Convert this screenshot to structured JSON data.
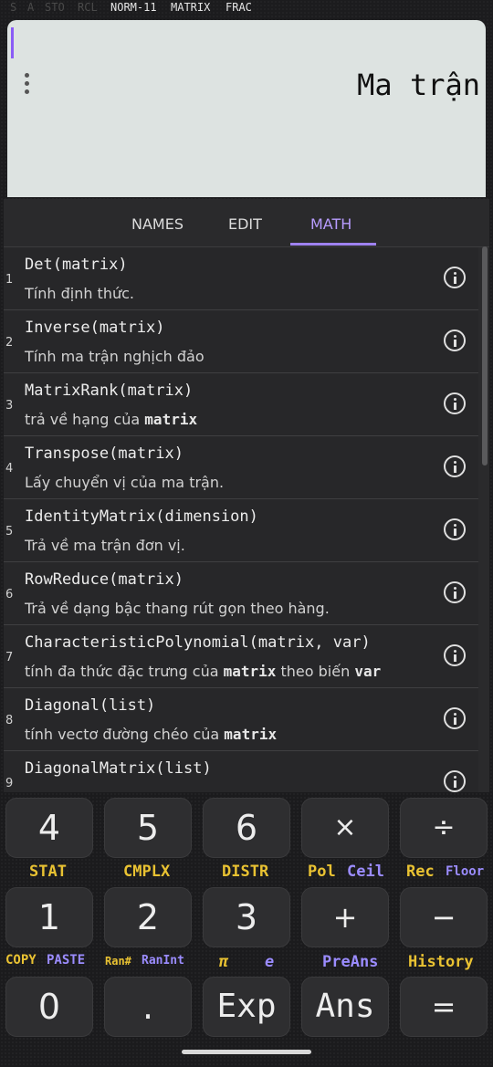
{
  "status": {
    "s": "S",
    "a": "A",
    "sto": "STO",
    "rcl": "RCL",
    "mode": "NORM-11",
    "matrix": "MATRIX",
    "frac": "FRAC"
  },
  "display": {
    "expression": "Ma trận"
  },
  "tabs": [
    "NAMES",
    "EDIT",
    "MATH"
  ],
  "items": [
    {
      "num": "1",
      "fn": "Det(matrix)",
      "desc": "Tính định thức."
    },
    {
      "num": "2",
      "fn": "Inverse(matrix)",
      "desc": "Tính ma trận nghịch đảo"
    },
    {
      "num": "3",
      "fn": "MatrixRank(matrix)",
      "desc_pre": "trả về hạng của ",
      "desc_bold": "matrix"
    },
    {
      "num": "4",
      "fn": "Transpose(matrix)",
      "desc": "Lấy chuyển vị của ma trận."
    },
    {
      "num": "5",
      "fn": "IdentityMatrix(dimension)",
      "desc": "Trả về ma trận đơn vị."
    },
    {
      "num": "6",
      "fn": "RowReduce(matrix)",
      "desc": "Trả về dạng bậc thang rút gọn theo hàng."
    },
    {
      "num": "7",
      "fn": "CharacteristicPolynomial(matrix, var)",
      "desc_pre": "tính đa thức đặc trưng của ",
      "desc_bold": "matrix",
      "desc_mid": " theo biến ",
      "desc_bold2": "var"
    },
    {
      "num": "8",
      "fn": "Diagonal(list)",
      "desc_pre": "tính vectơ đường chéo của ",
      "desc_bold": "matrix"
    },
    {
      "num": "9",
      "fn": "DiagonalMatrix(list)",
      "desc": ""
    }
  ],
  "keypad": {
    "row1": [
      "4",
      "5",
      "6",
      "×",
      "÷"
    ],
    "sec1": {
      "stat": "STAT",
      "cmplx": "CMPLX",
      "distr": "DISTR",
      "pol": "Pol",
      "ceil": "Ceil",
      "rec": "Rec",
      "floor": "Floor"
    },
    "row2": [
      "1",
      "2",
      "3",
      "+",
      "−"
    ],
    "sec2": {
      "copy": "COPY",
      "paste": "PASTE",
      "ran": "Ran#",
      "ranint": "RanInt",
      "pi": "π",
      "e": "e",
      "preans": "PreAns",
      "history": "History"
    },
    "row3": [
      "0",
      ".",
      "Exp",
      "Ans",
      "="
    ]
  },
  "colors": {
    "accent": "#9f82f0",
    "secondary_yellow": "#e9c232",
    "secondary_purple": "#9b8cff"
  }
}
